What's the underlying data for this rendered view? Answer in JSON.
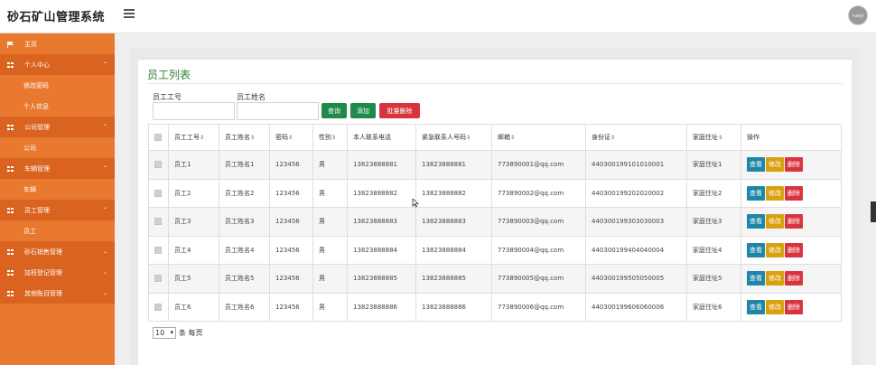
{
  "header": {
    "app_title": "砂石矿山管理系统",
    "avatar_text": "ruoyi"
  },
  "sidebar": {
    "items": [
      {
        "label": "主页",
        "type": "top",
        "icon": "flag-icon"
      },
      {
        "label": "个人中心",
        "type": "parent",
        "icon": "grid-icon",
        "arrow": "⌃"
      },
      {
        "label": "修改密码",
        "type": "child"
      },
      {
        "label": "个人信息",
        "type": "child"
      },
      {
        "label": "公司管理",
        "type": "parent",
        "icon": "grid-icon",
        "arrow": "⌃"
      },
      {
        "label": "公司",
        "type": "child"
      },
      {
        "label": "车辆管理",
        "type": "parent",
        "icon": "grid-icon",
        "arrow": "⌃"
      },
      {
        "label": "车辆",
        "type": "child"
      },
      {
        "label": "员工管理",
        "type": "parent",
        "icon": "grid-icon",
        "arrow": "⌃"
      },
      {
        "label": "员工",
        "type": "child"
      },
      {
        "label": "砂石销售管理",
        "type": "parent",
        "icon": "grid-icon",
        "arrow": "⌄"
      },
      {
        "label": "加班登记管理",
        "type": "parent",
        "icon": "grid-icon",
        "arrow": "⌄"
      },
      {
        "label": "其他账目管理",
        "type": "parent",
        "icon": "grid-icon",
        "arrow": "⌄"
      }
    ]
  },
  "panel": {
    "title": "员工列表",
    "search": {
      "emp_no_label": "员工工号",
      "emp_name_label": "员工姓名",
      "emp_no_value": "",
      "emp_name_value": "",
      "query_button": "查询",
      "add_button": "添加",
      "batch_delete_button": "批量删除"
    },
    "table": {
      "headers": [
        "员工工号",
        "员工姓名",
        "密码",
        "性别",
        "本人联系电话",
        "紧急联系人号码",
        "邮箱",
        "身份证",
        "家庭住址",
        "操作"
      ],
      "sortable": [
        true,
        true,
        true,
        true,
        false,
        true,
        true,
        true,
        true,
        false
      ],
      "sort_glyph": "⇕",
      "actions": {
        "view": "查看",
        "edit": "修改",
        "delete": "删除"
      },
      "rows": [
        [
          "员工1",
          "员工姓名1",
          "123456",
          "男",
          "13823888881",
          "13823888881",
          "773890001@qq.com",
          "440300199101010001",
          "家庭住址1"
        ],
        [
          "员工2",
          "员工姓名2",
          "123456",
          "男",
          "13823888882",
          "13823888882",
          "773890002@qq.com",
          "440300199202020002",
          "家庭住址2"
        ],
        [
          "员工3",
          "员工姓名3",
          "123456",
          "男",
          "13823888883",
          "13823888883",
          "773890003@qq.com",
          "440300199303030003",
          "家庭住址3"
        ],
        [
          "员工4",
          "员工姓名4",
          "123456",
          "男",
          "13823888884",
          "13823888884",
          "773890004@qq.com",
          "440300199404040004",
          "家庭住址4"
        ],
        [
          "员工5",
          "员工姓名5",
          "123456",
          "男",
          "13823888885",
          "13823888885",
          "773890005@qq.com",
          "440300199505050005",
          "家庭住址5"
        ],
        [
          "员工6",
          "员工姓名6",
          "123456",
          "男",
          "13823888886",
          "13823888886",
          "773890006@qq.com",
          "440300199606060006",
          "家庭住址6"
        ]
      ]
    },
    "pager": {
      "page_size": "10",
      "suffix": "条 每页"
    }
  },
  "colors": {
    "sidebar": "#e8792f",
    "sidebar_parent": "#d9631f",
    "title_green": "#2e7d32",
    "btn_green": "#1f8a4a",
    "btn_red": "#d9343e",
    "btn_view": "#2086a8",
    "btn_edit": "#d8a20e"
  }
}
